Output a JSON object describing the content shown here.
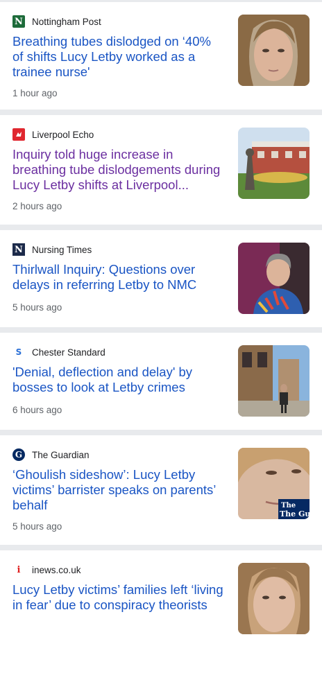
{
  "articles": [
    {
      "source": "Nottingham Post",
      "source_icon": "N",
      "icon_name": "nottingham-post-logo-icon",
      "icon_bg": "#1d6b3a",
      "headline": "Breathing tubes dislodged on ‘40% of shifts Lucy Letby worked as a trainee nurse'",
      "time": "1 hour ago",
      "visited": false,
      "thumb": "face"
    },
    {
      "source": "Liverpool Echo",
      "source_icon": "",
      "icon_name": "liverpool-echo-logo-icon",
      "icon_bg": "#e0272f",
      "headline": "Inquiry told huge increase in breathing tube dislodgements during Lucy Letby shifts at Liverpool...",
      "time": "2 hours ago",
      "visited": true,
      "thumb": "hospital"
    },
    {
      "source": "Nursing Times",
      "source_icon": "N",
      "icon_name": "nursing-times-logo-icon",
      "icon_bg": "#1c2a4a",
      "headline": "Thirlwall Inquiry: Questions over delays in referring Letby to NMC",
      "time": "5 hours ago",
      "visited": false,
      "thumb": "woman"
    },
    {
      "source": "Chester Standard",
      "source_icon": "S",
      "icon_name": "chester-standard-logo-icon",
      "icon_bg": "#ffffff",
      "headline": "'Denial, deflection and delay' by bosses to look at Letby crimes",
      "time": "6 hours ago",
      "visited": false,
      "thumb": "street"
    },
    {
      "source": "The Guardian",
      "source_icon": "G",
      "icon_name": "the-guardian-logo-icon",
      "icon_bg": "#052962",
      "headline": "‘Ghoulish sideshow’: Lucy Letby victims’ barrister speaks on parents’ behalf",
      "time": "5 hours ago",
      "visited": false,
      "thumb": "guardian",
      "thumb_text": "The Guardi"
    },
    {
      "source": "inews.co.uk",
      "source_icon": "i",
      "icon_name": "inews-logo-icon",
      "icon_bg": "#ffffff",
      "headline": "Lucy Letby victims’ families left ‘living in fear’ due to conspiracy theorists",
      "time": "",
      "visited": false,
      "thumb": "face"
    }
  ]
}
